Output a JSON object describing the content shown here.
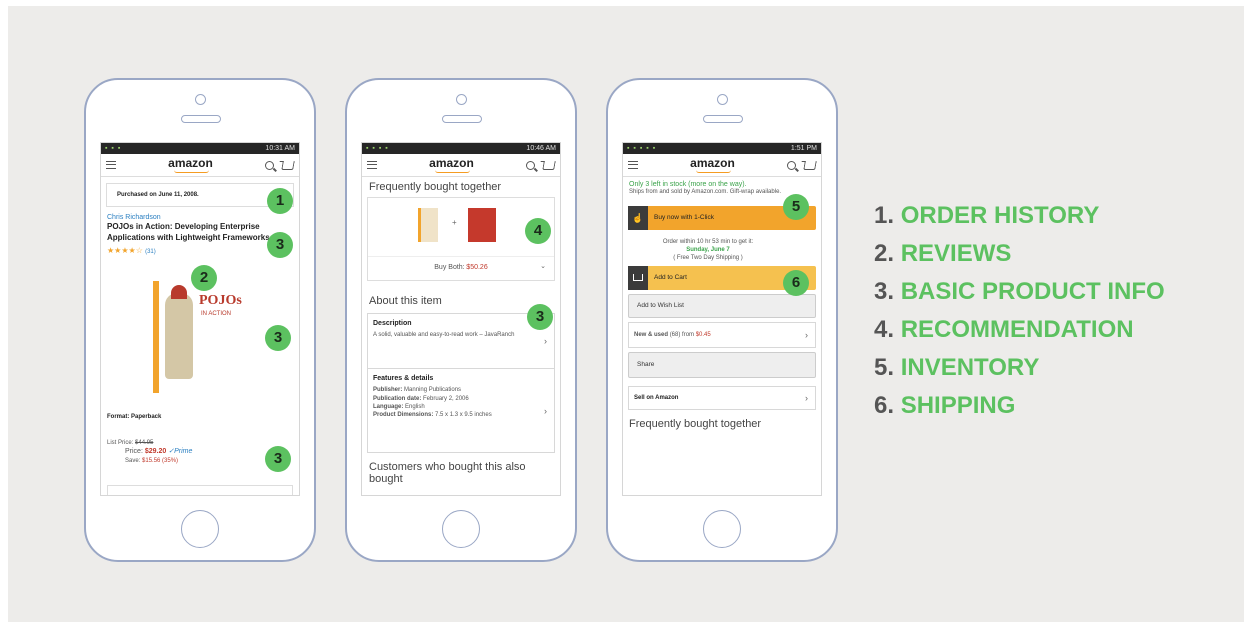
{
  "phone1": {
    "status_time": "10:31 AM",
    "logo": "amazon",
    "purchased": "Purchased on June 11, 2008.",
    "author": "Chris Richardson",
    "title": "POJOs in Action: Developing Enterprise Applications with Lightweight Frameworks",
    "stars": "★★★★☆",
    "review_count": "(31)",
    "cover_title": "POJOs",
    "cover_sub": "IN ACTION",
    "format": "Format: Paperback",
    "list_price_label": "List Price:",
    "list_price": "$44.95",
    "price_label": "Price:",
    "price": "$29.20",
    "prime": "✓Prime",
    "save_label": "Save:",
    "save": "$15.56 (35%)"
  },
  "phone2": {
    "status_time": "10:46 AM",
    "logo": "amazon",
    "fbt": "Frequently bought together",
    "buy_both_label": "Buy Both:",
    "buy_both_price": "$50.26",
    "about": "About this item",
    "desc_title": "Description",
    "desc_text": "A solid, valuable and easy-to-read work – JavaRanch",
    "features_title": "Features & details",
    "publisher_label": "Publisher:",
    "publisher": "Manning Publications",
    "pubdate_label": "Publication date:",
    "pubdate": "February 2, 2006",
    "language_label": "Language:",
    "language": "English",
    "dims_label": "Product Dimensions:",
    "dims": "7.5 x 1.3 x 9.5 inches",
    "customers": "Customers who bought this also bought"
  },
  "phone3": {
    "status_time": "1:51 PM",
    "logo": "amazon",
    "stock": "Only 3 left in stock (more on the way).",
    "ships": "Ships from and sold by Amazon.com. Gift-wrap available.",
    "buy_now": "Buy now with 1-Click",
    "order_within": "Order within 10 hr 53 min to get it:",
    "delivery_date": "Sunday, June 7",
    "free_ship": "( Free Two Day Shipping )",
    "add_cart": "Add to Cart",
    "wishlist": "Add to Wish List",
    "new_used_label": "New & used",
    "new_used_count": "(68) from",
    "new_used_price": "$0.45",
    "share": "Share",
    "sell": "Sell on Amazon",
    "fbt": "Frequently bought together"
  },
  "badges": [
    "1",
    "2",
    "3",
    "3",
    "3",
    "4",
    "3",
    "5",
    "6"
  ],
  "legend": [
    {
      "num": "1.",
      "label": "ORDER HISTORY"
    },
    {
      "num": "2.",
      "label": "REVIEWS"
    },
    {
      "num": "3.",
      "label": "BASIC PRODUCT INFO"
    },
    {
      "num": "4.",
      "label": "RECOMMENDATION"
    },
    {
      "num": "5.",
      "label": "INVENTORY"
    },
    {
      "num": "6.",
      "label": "SHIPPING"
    }
  ],
  "colors": {
    "accent": "#5cc160",
    "price": "#c0392b",
    "link": "#2a7fc1",
    "orange": "#f2a42c"
  },
  "icons": [
    "menu-icon",
    "search-icon",
    "cart-icon",
    "chevron-right-icon",
    "chevron-down-icon",
    "hand-icon",
    "cart-icon"
  ]
}
